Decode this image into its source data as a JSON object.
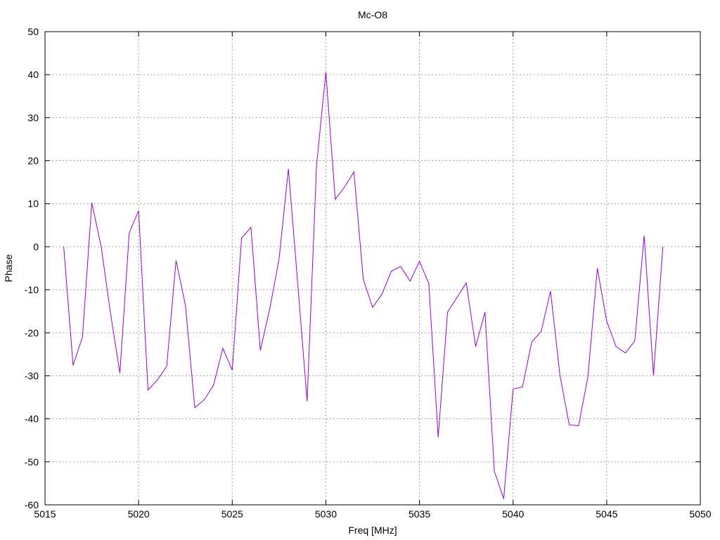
{
  "chart_data": {
    "type": "line",
    "title": "Mc-O8",
    "xlabel": "Freq [MHz]",
    "ylabel": "Phase",
    "xlim": [
      5015,
      5050
    ],
    "ylim": [
      -60,
      50
    ],
    "xticks": [
      5015,
      5020,
      5025,
      5030,
      5035,
      5040,
      5045,
      5050
    ],
    "yticks": [
      -60,
      -50,
      -40,
      -30,
      -20,
      -10,
      0,
      10,
      20,
      30,
      40,
      50
    ],
    "grid": true,
    "legend": "none",
    "series": [
      {
        "color": "#9400d3",
        "points": [
          [
            5016.0,
            0.0
          ],
          [
            5016.5,
            -27.6
          ],
          [
            5017.0,
            -21.0
          ],
          [
            5017.5,
            10.2
          ],
          [
            5018.0,
            0.0
          ],
          [
            5018.5,
            -15.5
          ],
          [
            5019.0,
            -29.4
          ],
          [
            5019.5,
            3.2
          ],
          [
            5020.0,
            8.4
          ],
          [
            5020.5,
            -33.3
          ],
          [
            5021.0,
            -31.0
          ],
          [
            5021.5,
            -27.8
          ],
          [
            5022.0,
            -3.2
          ],
          [
            5022.5,
            -13.6
          ],
          [
            5023.0,
            -37.4
          ],
          [
            5023.5,
            -35.6
          ],
          [
            5024.0,
            -32.2
          ],
          [
            5024.5,
            -23.6
          ],
          [
            5025.0,
            -28.7
          ],
          [
            5025.5,
            2.0
          ],
          [
            5026.0,
            4.5
          ],
          [
            5026.5,
            -24.1
          ],
          [
            5027.0,
            -14.5
          ],
          [
            5027.5,
            -2.9
          ],
          [
            5028.0,
            18.1
          ],
          [
            5028.5,
            -8.7
          ],
          [
            5029.0,
            -35.9
          ],
          [
            5029.5,
            18.7
          ],
          [
            5030.0,
            40.6
          ],
          [
            5030.5,
            11.0
          ],
          [
            5031.0,
            13.9
          ],
          [
            5031.5,
            17.4
          ],
          [
            5032.0,
            -7.6
          ],
          [
            5032.5,
            -14.1
          ],
          [
            5033.0,
            -11.0
          ],
          [
            5033.5,
            -5.7
          ],
          [
            5034.0,
            -4.6
          ],
          [
            5034.5,
            -8.0
          ],
          [
            5035.0,
            -3.4
          ],
          [
            5035.5,
            -8.6
          ],
          [
            5036.0,
            -44.3
          ],
          [
            5036.5,
            -15.2
          ],
          [
            5037.0,
            -11.8
          ],
          [
            5037.5,
            -8.4
          ],
          [
            5038.0,
            -23.2
          ],
          [
            5038.5,
            -15.2
          ],
          [
            5039.0,
            -52.2
          ],
          [
            5039.5,
            -58.6
          ],
          [
            5040.0,
            -33.1
          ],
          [
            5040.5,
            -32.6
          ],
          [
            5041.0,
            -22.1
          ],
          [
            5041.5,
            -19.7
          ],
          [
            5042.0,
            -10.3
          ],
          [
            5042.5,
            -29.8
          ],
          [
            5043.0,
            -41.4
          ],
          [
            5043.5,
            -41.6
          ],
          [
            5044.0,
            -30.1
          ],
          [
            5044.5,
            -5.0
          ],
          [
            5045.0,
            -17.3
          ],
          [
            5045.5,
            -23.2
          ],
          [
            5046.0,
            -24.7
          ],
          [
            5046.5,
            -21.9
          ],
          [
            5047.0,
            2.6
          ],
          [
            5047.5,
            -29.9
          ],
          [
            5048.0,
            0.0
          ]
        ]
      }
    ]
  }
}
